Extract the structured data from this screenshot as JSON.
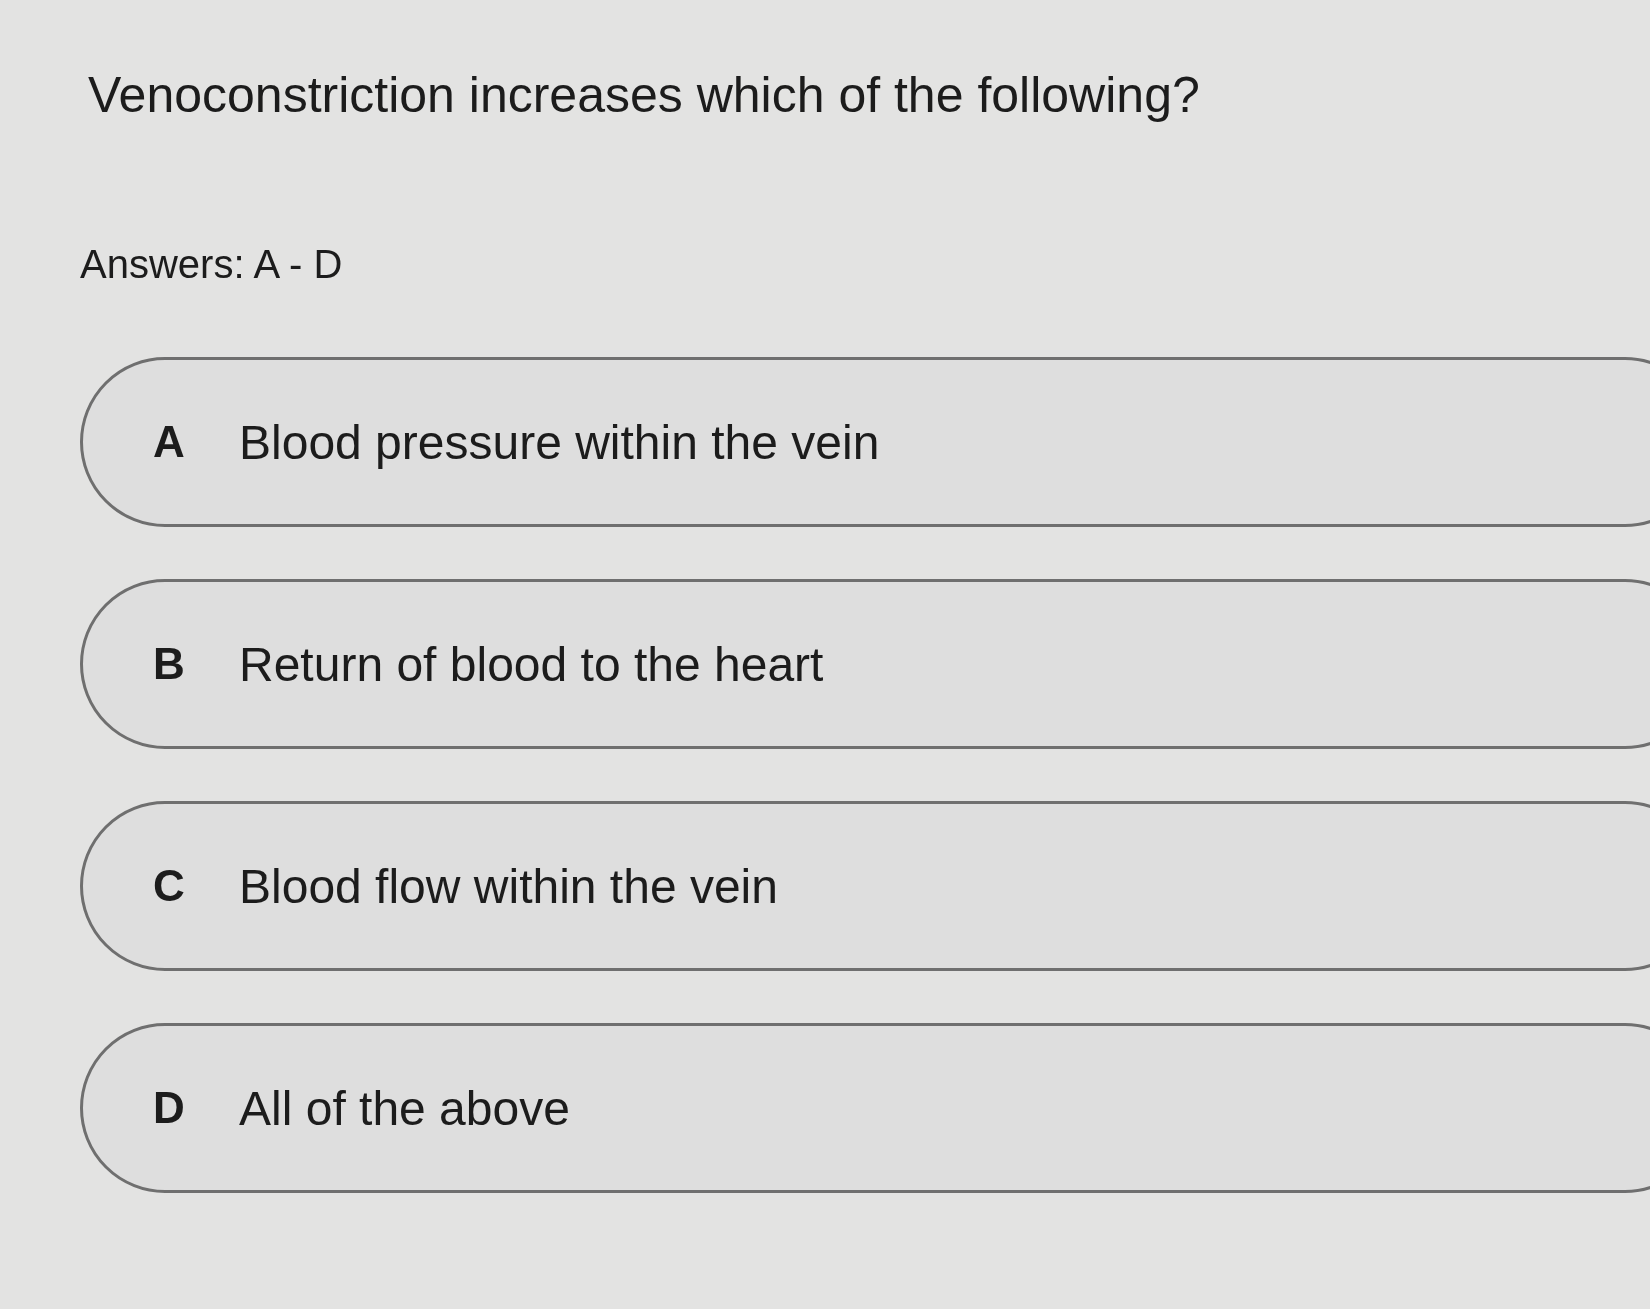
{
  "question": "Venoconstriction increases which of the following?",
  "answers_label": "Answers: A - D",
  "options": [
    {
      "letter": "A",
      "text": "Blood pressure within the vein"
    },
    {
      "letter": "B",
      "text": "Return of blood to the heart"
    },
    {
      "letter": "C",
      "text": "Blood flow within the vein"
    },
    {
      "letter": "D",
      "text": "All of the above"
    }
  ]
}
